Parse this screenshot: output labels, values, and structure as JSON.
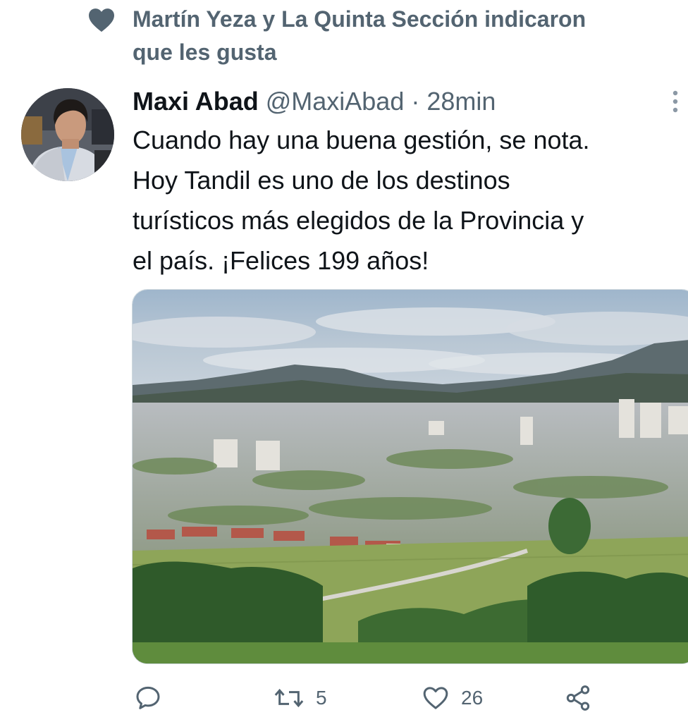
{
  "social_context": {
    "icon": "heart-filled-icon",
    "text_line1": "Martín Yeza y La Quinta Sección indicaron",
    "text_line2": "que les gusta"
  },
  "tweet": {
    "author_name": "Maxi Abad",
    "handle": "@MaxiAbad",
    "separator": "·",
    "time": "28min",
    "text_lines": [
      "Cuando hay una buena gestión, se nota.",
      "Hoy Tandil es uno de los destinos",
      "turísticos más elegidos de la Provincia y",
      "el país. ¡Felices 199 años!"
    ],
    "media_description_icon": "city-landscape-photo"
  },
  "actions": {
    "reply_icon": "reply-icon",
    "retweet_icon": "retweet-icon",
    "retweet_count": "5",
    "like_icon": "like-icon",
    "like_count": "26",
    "share_icon": "share-icon"
  },
  "colors": {
    "text_primary": "#0f1419",
    "text_secondary": "#536471",
    "border": "#cfd9de"
  }
}
